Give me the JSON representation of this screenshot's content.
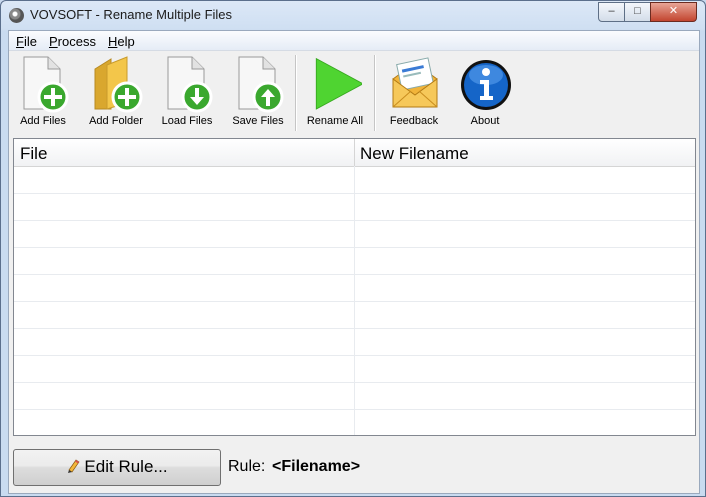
{
  "window": {
    "title": "VOVSOFT - Rename Multiple Files",
    "controls": {
      "minimize": "–",
      "maximize": "□",
      "close": "✕"
    }
  },
  "menu": {
    "items": [
      {
        "accel": "F",
        "rest": "ile"
      },
      {
        "accel": "P",
        "rest": "rocess"
      },
      {
        "accel": "H",
        "rest": "elp"
      }
    ]
  },
  "toolbar": {
    "items": [
      {
        "label": "Add Files",
        "icon": "add-files-icon"
      },
      {
        "label": "Add Folder",
        "icon": "add-folder-icon"
      },
      {
        "label": "Load Files",
        "icon": "load-files-icon"
      },
      {
        "label": "Save Files",
        "icon": "save-files-icon"
      },
      {
        "label": "Rename All",
        "icon": "play-icon"
      },
      {
        "label": "Feedback",
        "icon": "mail-icon"
      },
      {
        "label": "About",
        "icon": "info-icon"
      }
    ]
  },
  "grid": {
    "columns": [
      "File",
      "New Filename"
    ]
  },
  "footer": {
    "edit_button": "Edit Rule...",
    "rule_label": "Rule:",
    "rule_value": "<Filename>"
  },
  "colors": {
    "accent_green": "#3aa82e",
    "play_green": "#4fd431",
    "info_blue": "#1565c8",
    "folder_yellow": "#f3c64a"
  }
}
